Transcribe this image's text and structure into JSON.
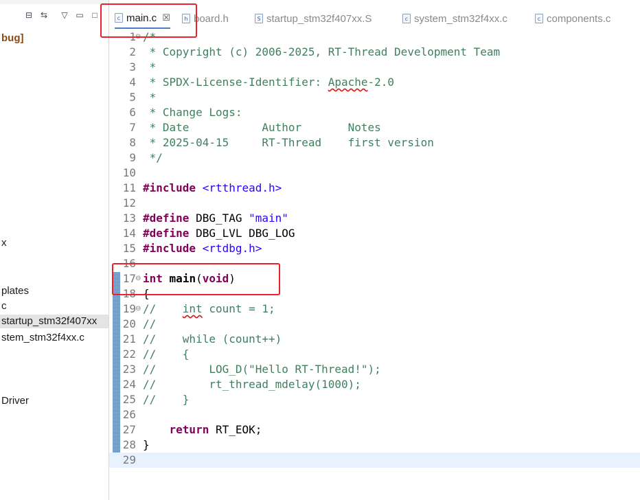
{
  "left_panel": {
    "items": [
      {
        "label": "bug]",
        "bold": true
      },
      {
        "label": "x"
      },
      {
        "label": "plates"
      },
      {
        "label": "c"
      },
      {
        "label": "startup_stm32f407xx",
        "selected": true
      },
      {
        "label": "stem_stm32f4xx.c"
      },
      {
        "label": "Driver"
      }
    ]
  },
  "tabs": [
    {
      "label": "main.c",
      "icon": "c-file-icon",
      "active": true,
      "close": "☒"
    },
    {
      "label": "board.h",
      "icon": "h-file-icon"
    },
    {
      "label": "startup_stm32f407xx.S",
      "icon": "s-file-icon"
    },
    {
      "label": "system_stm32f4xx.c",
      "icon": "c-file-icon"
    },
    {
      "label": "components.c",
      "icon": "c-file-icon"
    }
  ],
  "editor": {
    "lines": [
      {
        "n": "1",
        "fold": "⊖",
        "parts": [
          {
            "t": "/*",
            "c": "cm"
          }
        ]
      },
      {
        "n": "2",
        "parts": [
          {
            "t": " * Copyright (c) 2006-2025, RT-Thread Development Team",
            "c": "cm"
          }
        ]
      },
      {
        "n": "3",
        "parts": [
          {
            "t": " *",
            "c": "cm"
          }
        ]
      },
      {
        "n": "4",
        "parts": [
          {
            "t": " * SPDX-License-Identifier: ",
            "c": "cm"
          },
          {
            "t": "Apache",
            "c": "cm sq"
          },
          {
            "t": "-2.0",
            "c": "cm"
          }
        ]
      },
      {
        "n": "5",
        "parts": [
          {
            "t": " *",
            "c": "cm"
          }
        ]
      },
      {
        "n": "6",
        "parts": [
          {
            "t": " * Change Logs:",
            "c": "cm"
          }
        ]
      },
      {
        "n": "7",
        "parts": [
          {
            "t": " * Date           Author       Notes",
            "c": "cm"
          }
        ]
      },
      {
        "n": "8",
        "parts": [
          {
            "t": " * 2025-04-15     RT-Thread    first version",
            "c": "cm"
          }
        ]
      },
      {
        "n": "9",
        "parts": [
          {
            "t": " */",
            "c": "cm"
          }
        ]
      },
      {
        "n": "10",
        "parts": []
      },
      {
        "n": "11",
        "parts": [
          {
            "t": "#include",
            "c": "kw"
          },
          {
            "t": " ",
            "c": "pl"
          },
          {
            "t": "<rtthread.h>",
            "c": "str"
          }
        ]
      },
      {
        "n": "12",
        "parts": []
      },
      {
        "n": "13",
        "parts": [
          {
            "t": "#define",
            "c": "kw"
          },
          {
            "t": " DBG_TAG ",
            "c": "pl"
          },
          {
            "t": "\"main\"",
            "c": "str"
          }
        ]
      },
      {
        "n": "14",
        "parts": [
          {
            "t": "#define",
            "c": "kw"
          },
          {
            "t": " DBG_LVL DBG_LOG",
            "c": "pl"
          }
        ]
      },
      {
        "n": "15",
        "parts": [
          {
            "t": "#include",
            "c": "kw"
          },
          {
            "t": " ",
            "c": "pl"
          },
          {
            "t": "<rtdbg.h>",
            "c": "str"
          }
        ]
      },
      {
        "n": "16",
        "parts": []
      },
      {
        "n": "17",
        "fold": "⊖",
        "parts": [
          {
            "t": "int",
            "c": "kw"
          },
          {
            "t": " ",
            "c": "pl"
          },
          {
            "t": "main",
            "c": "pl b"
          },
          {
            "t": "(",
            "c": "pl"
          },
          {
            "t": "void",
            "c": "kw"
          },
          {
            "t": ")",
            "c": "pl"
          }
        ]
      },
      {
        "n": "18",
        "parts": [
          {
            "t": "{",
            "c": "pl"
          }
        ]
      },
      {
        "n": "19",
        "fold": "⊖",
        "parts": [
          {
            "t": "//    ",
            "c": "cm"
          },
          {
            "t": "int",
            "c": "cm sq"
          },
          {
            "t": " count = 1;",
            "c": "cm"
          }
        ]
      },
      {
        "n": "20",
        "parts": [
          {
            "t": "//",
            "c": "cm"
          }
        ]
      },
      {
        "n": "21",
        "parts": [
          {
            "t": "//    while (count++)",
            "c": "cm"
          }
        ]
      },
      {
        "n": "22",
        "parts": [
          {
            "t": "//    {",
            "c": "cm"
          }
        ]
      },
      {
        "n": "23",
        "parts": [
          {
            "t": "//        LOG_D(\"Hello RT-Thread!\");",
            "c": "cm"
          }
        ]
      },
      {
        "n": "24",
        "parts": [
          {
            "t": "//        rt_thread_mdelay(1000);",
            "c": "cm"
          }
        ]
      },
      {
        "n": "25",
        "parts": [
          {
            "t": "//    }",
            "c": "cm"
          }
        ]
      },
      {
        "n": "26",
        "parts": []
      },
      {
        "n": "27",
        "parts": [
          {
            "t": "    ",
            "c": "pl"
          },
          {
            "t": "return",
            "c": "kw"
          },
          {
            "t": " RT_EOK;",
            "c": "pl"
          }
        ]
      },
      {
        "n": "28",
        "parts": [
          {
            "t": "}",
            "c": "pl"
          }
        ]
      },
      {
        "n": "29",
        "current": true,
        "parts": []
      }
    ]
  },
  "colors": {
    "comment": "#3f7f5f",
    "keyword": "#7f0055",
    "string": "#2a00ff",
    "annotation": "#e8212b",
    "current_line": "#e8f2fe"
  }
}
